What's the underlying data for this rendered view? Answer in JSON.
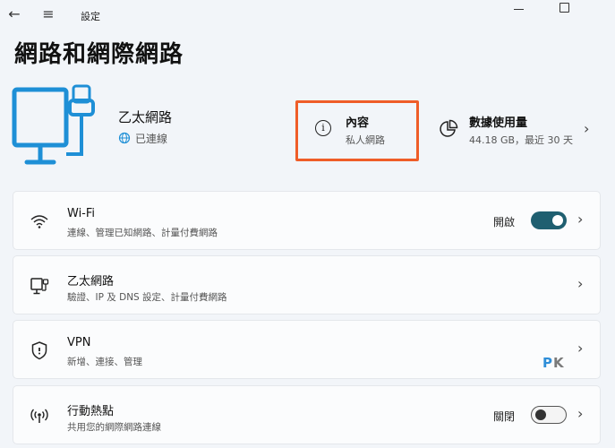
{
  "window": {
    "title": "設定",
    "back_glyph": "←",
    "menu_glyph": "≡"
  },
  "page": {
    "title": "網路和網際網路"
  },
  "connection": {
    "name": "乙太網路",
    "status": "已連線"
  },
  "properties": {
    "title": "內容",
    "subtitle": "私人網路",
    "icon_glyph": "i"
  },
  "data_usage": {
    "title": "數據使用量",
    "subtitle": "44.18 GB，最近 30 天",
    "chevron": "›"
  },
  "cards": [
    {
      "title": "Wi-Fi",
      "subtitle": "連線、管理已知網路、計量付費網路",
      "state_label": "開啟",
      "toggle": "on",
      "chevron": "›",
      "icon": "wifi-icon"
    },
    {
      "title": "乙太網路",
      "subtitle": "驗證、IP 及 DNS 設定、計量付費網路",
      "chevron": "›",
      "icon": "ethernet-icon"
    },
    {
      "title": "VPN",
      "subtitle": "新增、連接、管理",
      "chevron": "›",
      "icon": "shield-icon"
    },
    {
      "title": "行動熱點",
      "subtitle": "共用您的網際網路連線",
      "state_label": "關閉",
      "toggle": "off",
      "chevron": "›",
      "icon": "hotspot-icon"
    }
  ],
  "watermark": {
    "p": "P",
    "k": "K"
  },
  "colors": {
    "accent": "#1f5f70",
    "highlight": "#ef5d28",
    "hero_icon": "#1e8fd6"
  }
}
